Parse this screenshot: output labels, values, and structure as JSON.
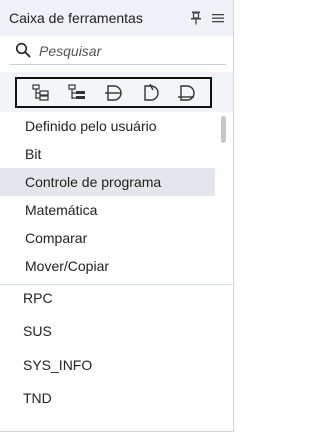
{
  "panel": {
    "title": "Caixa de ferramentas",
    "pin_icon": "pin-icon",
    "menu_icon": "menu-icon"
  },
  "search": {
    "placeholder": "Pesquisar",
    "value": "",
    "icon": "search-icon"
  },
  "toolbar": {
    "buttons": [
      {
        "icon": "tree-expand-icon"
      },
      {
        "icon": "tree-collapse-icon"
      },
      {
        "icon": "block-icon-a"
      },
      {
        "icon": "block-icon-b"
      },
      {
        "icon": "block-icon-c"
      }
    ]
  },
  "categories": [
    {
      "label": "Definido pelo usuário",
      "selected": false
    },
    {
      "label": "Bit",
      "selected": false
    },
    {
      "label": "Controle de programa",
      "selected": true
    },
    {
      "label": "Matemática",
      "selected": false
    },
    {
      "label": "Comparar",
      "selected": false
    },
    {
      "label": "Mover/Copiar",
      "selected": false
    }
  ],
  "instructions": [
    {
      "label": "RPC"
    },
    {
      "label": "SUS"
    },
    {
      "label": "SYS_INFO"
    },
    {
      "label": "TND"
    }
  ],
  "colors": {
    "header_bg": "#eef1f5",
    "selected_bg": "#e3e6ea",
    "toolbar_border": "#111111"
  }
}
